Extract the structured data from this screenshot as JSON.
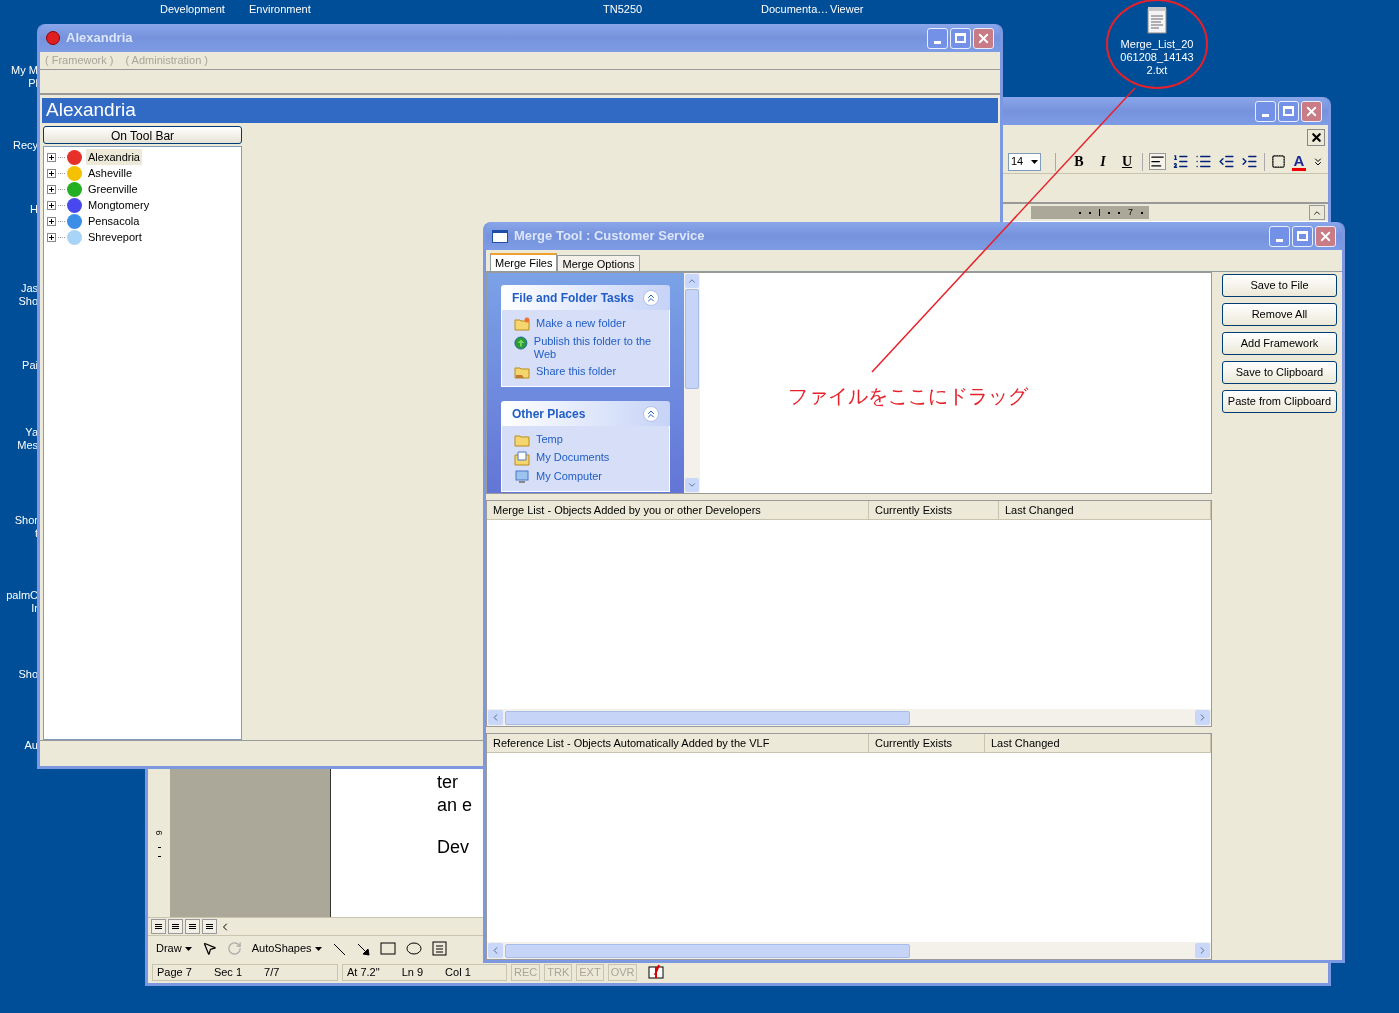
{
  "desktop": {
    "top_labels": [
      "Development",
      "Environment",
      "TN5250",
      "Documenta…",
      "Viewer"
    ],
    "left_icons": [
      {
        "lines": [
          "My M",
          "Pl"
        ]
      },
      {
        "lines": [
          "Recy"
        ]
      },
      {
        "lines": [
          "H"
        ]
      },
      {
        "lines": [
          "Jas",
          "Sho"
        ]
      },
      {
        "lines": [
          "Pai"
        ]
      },
      {
        "lines": [
          "Ya",
          "Mes"
        ]
      },
      {
        "lines": [
          "Shor",
          "t"
        ]
      },
      {
        "lines": [
          "palmC",
          "Ir"
        ]
      },
      {
        "lines": [
          "Sho"
        ]
      },
      {
        "lines": [
          "Au"
        ]
      }
    ],
    "file_icon": {
      "label": "Merge_List_20061208_141432.txt"
    }
  },
  "annotation": {
    "text": "ファイルをここにドラッグ"
  },
  "word": {
    "font_size": "14",
    "format_buttons": [
      "B",
      "I",
      "U"
    ],
    "font_color_label": "A",
    "ruler_number": "7",
    "vertical_ruler_number": "6",
    "page_lines": [
      "ter",
      "an e",
      "Dev"
    ],
    "draw_menu": "Draw",
    "autoshapes_menu": "AutoShapes",
    "status_groups": [
      [
        "Page 7",
        "Sec 1",
        "7/7"
      ],
      [
        "At 7.2\"",
        "Ln 9",
        "Col 1"
      ]
    ],
    "indicators": [
      {
        "label": "REC",
        "disabled": true
      },
      {
        "label": "TRK",
        "disabled": true
      },
      {
        "label": "EXT",
        "disabled": true
      },
      {
        "label": "OVR",
        "disabled": true
      }
    ]
  },
  "alexandria": {
    "title": "Alexandria",
    "menu": [
      {
        "label": "( Framework )",
        "disabled": true
      },
      {
        "label": "( Administration )",
        "disabled": true
      }
    ],
    "banner": "Alexandria",
    "toolbar_button": "On Tool Bar",
    "tree": [
      {
        "label": "Alexandria",
        "color": "#e8302a",
        "selected": true,
        "expanded": false
      },
      {
        "label": "Asheville",
        "color": "#f5c000",
        "selected": false,
        "expanded": false
      },
      {
        "label": "Greenville",
        "color": "#22b022",
        "selected": false,
        "expanded": false
      },
      {
        "label": "Mongtomery",
        "color": "#4848f0",
        "selected": false,
        "expanded": false
      },
      {
        "label": "Pensacola",
        "color": "#3a8ee8",
        "selected": false,
        "expanded": false
      },
      {
        "label": "Shreveport",
        "color": "#a8d4f8",
        "selected": false,
        "expanded": false
      }
    ]
  },
  "merge": {
    "title": "Merge Tool : Customer Service",
    "tabs": [
      {
        "label": "Merge Files",
        "selected": true
      },
      {
        "label": "Merge Options",
        "selected": false
      }
    ],
    "task_groups": [
      {
        "title": "File and Folder Tasks",
        "expanded": true,
        "items": [
          {
            "label": "Make a new folder",
            "kind": "new-folder"
          },
          {
            "label": "Publish this folder to the Web",
            "kind": "publish"
          },
          {
            "label": "Share this folder",
            "kind": "share"
          }
        ]
      },
      {
        "title": "Other Places",
        "expanded": true,
        "items": [
          {
            "label": "Temp",
            "kind": "folder"
          },
          {
            "label": "My Documents",
            "kind": "documents"
          },
          {
            "label": "My Computer",
            "kind": "computer"
          }
        ]
      }
    ],
    "actions": [
      "Save to File",
      "Remove All",
      "Add Framework",
      "Save to Clipboard",
      "Paste from Clipboard"
    ],
    "merge_list": {
      "columns": [
        "Merge List - Objects Added by you or other Developers",
        "Currently Exists",
        "Last Changed"
      ]
    },
    "reference_list": {
      "columns": [
        "Reference List -  Objects Automatically Added by the VLF",
        "Currently Exists",
        "Last Changed"
      ]
    }
  }
}
